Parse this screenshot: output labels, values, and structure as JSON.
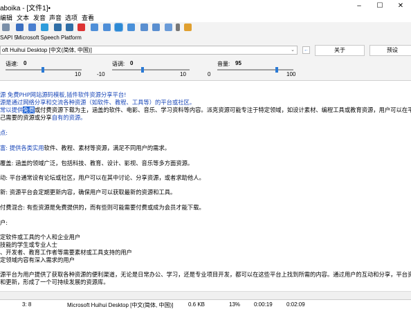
{
  "titlebar": {
    "title": "aboika - [文件1]•",
    "min": "–",
    "max": "☐",
    "close": "✕"
  },
  "menu": [
    "编辑",
    "文本",
    "发音",
    "声音",
    "选项",
    "查看"
  ],
  "voicebar": {
    "engine": "SAPI 5",
    "platform": "Microsoft Speech Platform"
  },
  "voice_select": {
    "value": "oft Huihui Desktop [中文(简体, 中国)]"
  },
  "buttons": {
    "about": "关于",
    "preset": "预设"
  },
  "sliders": {
    "rate": {
      "label": "语速:",
      "value": "0",
      "min": "",
      "max": "10",
      "level": 0.5
    },
    "pitch": {
      "label": "语调:",
      "value": "0",
      "min": "-10",
      "max": "10",
      "level": 0.5
    },
    "volume": {
      "label": "音量:",
      "value": "95",
      "min": "0",
      "max": "100",
      "level": 0.95
    }
  },
  "editor": {
    "l1": "源 免费PHP网站源码模板,插件软件资源分享平台!",
    "l2": "源是通过网络分享和交流各种资源（如软件、教程、工具等）的平台或社区。",
    "l3a": "常以提供",
    "l3b": "免费",
    "l3c": "或付费资源下载为主，涵盖的软件、电影、音乐、学习资料等内容。派克资源可能专注于特定领域，如设计素材、编程工具或教育资源，用户可以在平",
    "l4": "己需要的资源或分享",
    "l4b": "自有的资源。",
    "h1": "点:",
    "p1a": "富: 提供各类实用",
    "p1b": "软件、教程、素材等资源，满足不同用户的需求。",
    "p2": "覆盖: 涵盖的领域广泛，包括科技、教育、设计、影视、音乐等多方面资源。",
    "p3": "动: 平台通常设有论坛或社区，用户可以在其中讨论、分享资源，或者求助他人。",
    "p4": "新: 资源平台会定期更新内容，确保用户可以获取最新的资源和工具。",
    "p5": "付费混合: 有些资源是免费提供的，而有些则可能需要付费或成为会员才能下载。",
    "h2": "户:",
    "u1": "定软件或工具的个人和企业用户",
    "u2": "技能的学生或专业人士",
    "u3": "、开发者、教育工作者等需要素材或工具支持的用户",
    "u4": "定领域内容有深入需求的用户",
    "s1": "源平台为用户提供了获取各种资源的便利渠道，无论是日常办公、学习，还是专业项目开发，都可以在这些平台上找到所需的内容。通过用户的互动和分享，平台资",
    "s2": "和更新，形成了一个可持续发展的资源库。"
  },
  "status": {
    "pos": "3:  8",
    "voice": "Microsoft Huihui Desktop [中文(简体, 中国)]",
    "size": "0.6 KB",
    "percent": "13%",
    "elapsed": "0:00:19",
    "total": "0:02:09"
  }
}
